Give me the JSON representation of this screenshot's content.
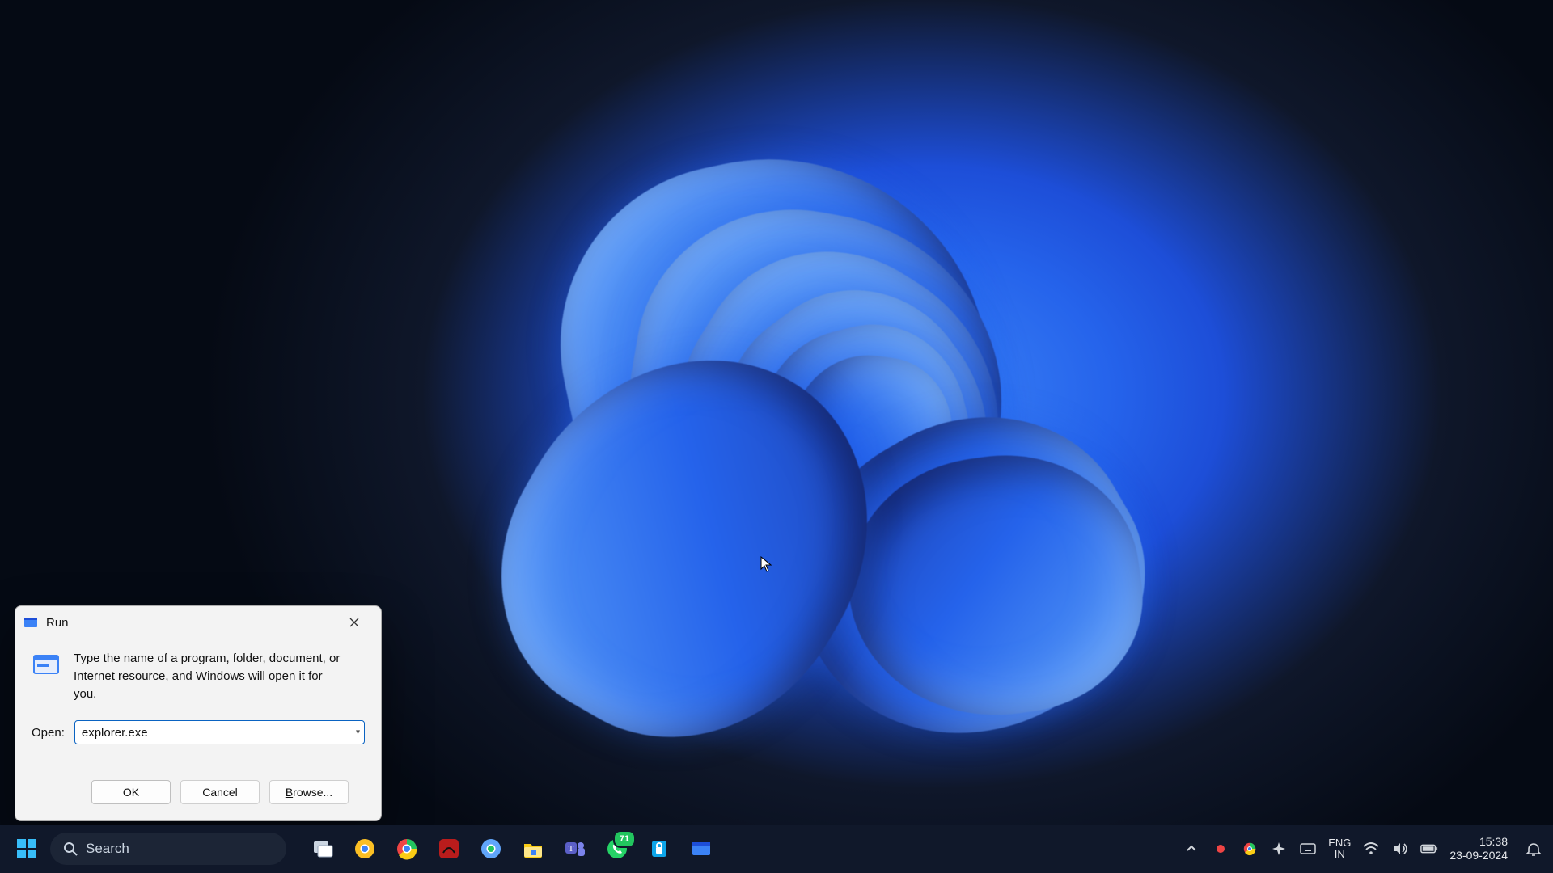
{
  "run_dialog": {
    "title": "Run",
    "description": "Type the name of a program, folder, document, or Internet resource, and Windows will open it for you.",
    "open_label": "Open:",
    "open_value": "explorer.exe",
    "buttons": {
      "ok": "OK",
      "cancel": "Cancel",
      "browse": "Browse..."
    },
    "browse_accel_char": "B"
  },
  "taskbar": {
    "search_placeholder": "Search",
    "apps": [
      {
        "name": "task-view"
      },
      {
        "name": "chrome-canary"
      },
      {
        "name": "chrome"
      },
      {
        "name": "app-red"
      },
      {
        "name": "chrome-beta"
      },
      {
        "name": "file-explorer"
      },
      {
        "name": "microsoft-teams"
      },
      {
        "name": "whatsapp",
        "badge": "71"
      },
      {
        "name": "app-lock"
      },
      {
        "name": "run-app"
      }
    ],
    "tray": {
      "overflow": "︿",
      "recording": true,
      "lang_top": "ENG",
      "lang_bottom": "IN",
      "time": "15:38",
      "date": "23-09-2024"
    }
  }
}
